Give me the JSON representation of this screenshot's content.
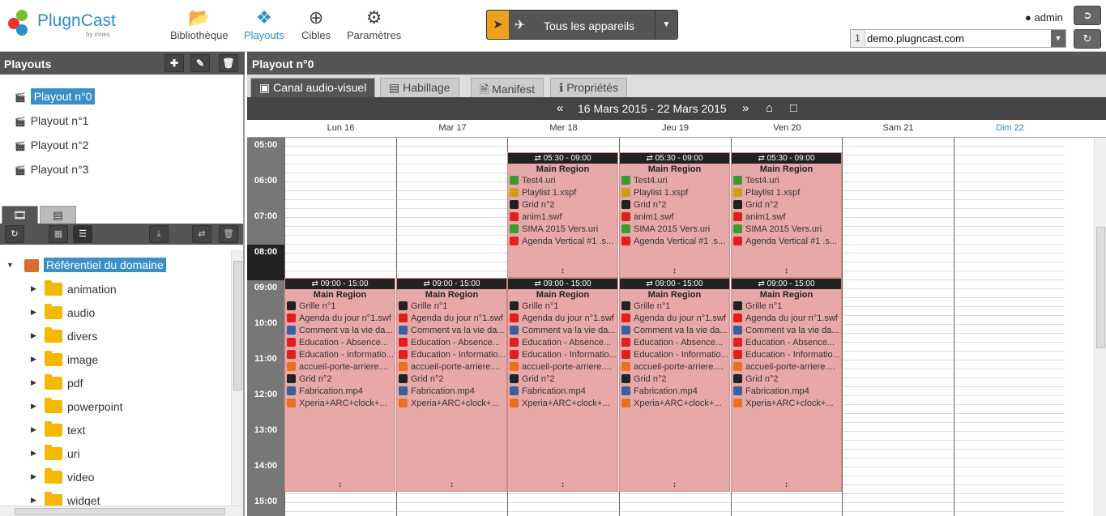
{
  "app": {
    "logo": "PlugnCast",
    "logo_sub": "by innes"
  },
  "nav": [
    {
      "label": "Bibliothèque",
      "icon": "folder-open-icon"
    },
    {
      "label": "Playouts",
      "icon": "puzzle-icon"
    },
    {
      "label": "Cibles",
      "icon": "target-icon"
    },
    {
      "label": "Paramètres",
      "icon": "gears-icon"
    }
  ],
  "device_selector": {
    "label": "Tous les appareils"
  },
  "user": {
    "name": "admin"
  },
  "domain": {
    "index": "1",
    "value": "demo.plugncast.com"
  },
  "left": {
    "title": "Playouts",
    "playouts": [
      "Playout n°0",
      "Playout n°1",
      "Playout n°2",
      "Playout n°3"
    ],
    "tree_root": "Référentiel du domaine",
    "folders": [
      "animation",
      "audio",
      "divers",
      "image",
      "pdf",
      "powerpoint",
      "text",
      "uri",
      "video",
      "widget"
    ]
  },
  "main": {
    "title": "Playout n°0",
    "tabs": [
      "Canal audio-visuel",
      "Habillage",
      "Manifest",
      "Propriétés"
    ],
    "week": "16 Mars 2015 - 22 Mars 2015",
    "days": [
      "Lun 16",
      "Mar 17",
      "Mer 18",
      "Jeu 19",
      "Ven 20",
      "Sam 21",
      "Dim 22"
    ],
    "hours": [
      "05:00",
      "06:00",
      "07:00",
      "08:00",
      "09:00",
      "10:00",
      "11:00",
      "12:00",
      "13:00",
      "14:00",
      "15:00"
    ],
    "morning_slot": {
      "time": "05:30 - 09:00",
      "region": "Main Region",
      "items": [
        "Test4.uri",
        "Playlist 1.xspf",
        "Grid n°2",
        "anim1.swf",
        "SIMA 2015 Vers.uri",
        "Agenda Vertical #1 .s..."
      ]
    },
    "day_slot": {
      "time": "09:00 - 15:00",
      "region": "Main Region",
      "items": [
        "Grille n°1",
        "Agenda du jour n°1.swf",
        "Comment va la vie da...",
        "Education - Absence...",
        "Education - Informatio...",
        "accueil-porte-arriere....",
        "Grid n°2",
        "Fabrication.mp4",
        "Xperia+ARC+clock+..."
      ]
    }
  },
  "colors": {
    "accent": "#2a8fc6",
    "slot": "#e8a8a8",
    "rocket": "#f0a020",
    "folder": "#f5b800"
  }
}
